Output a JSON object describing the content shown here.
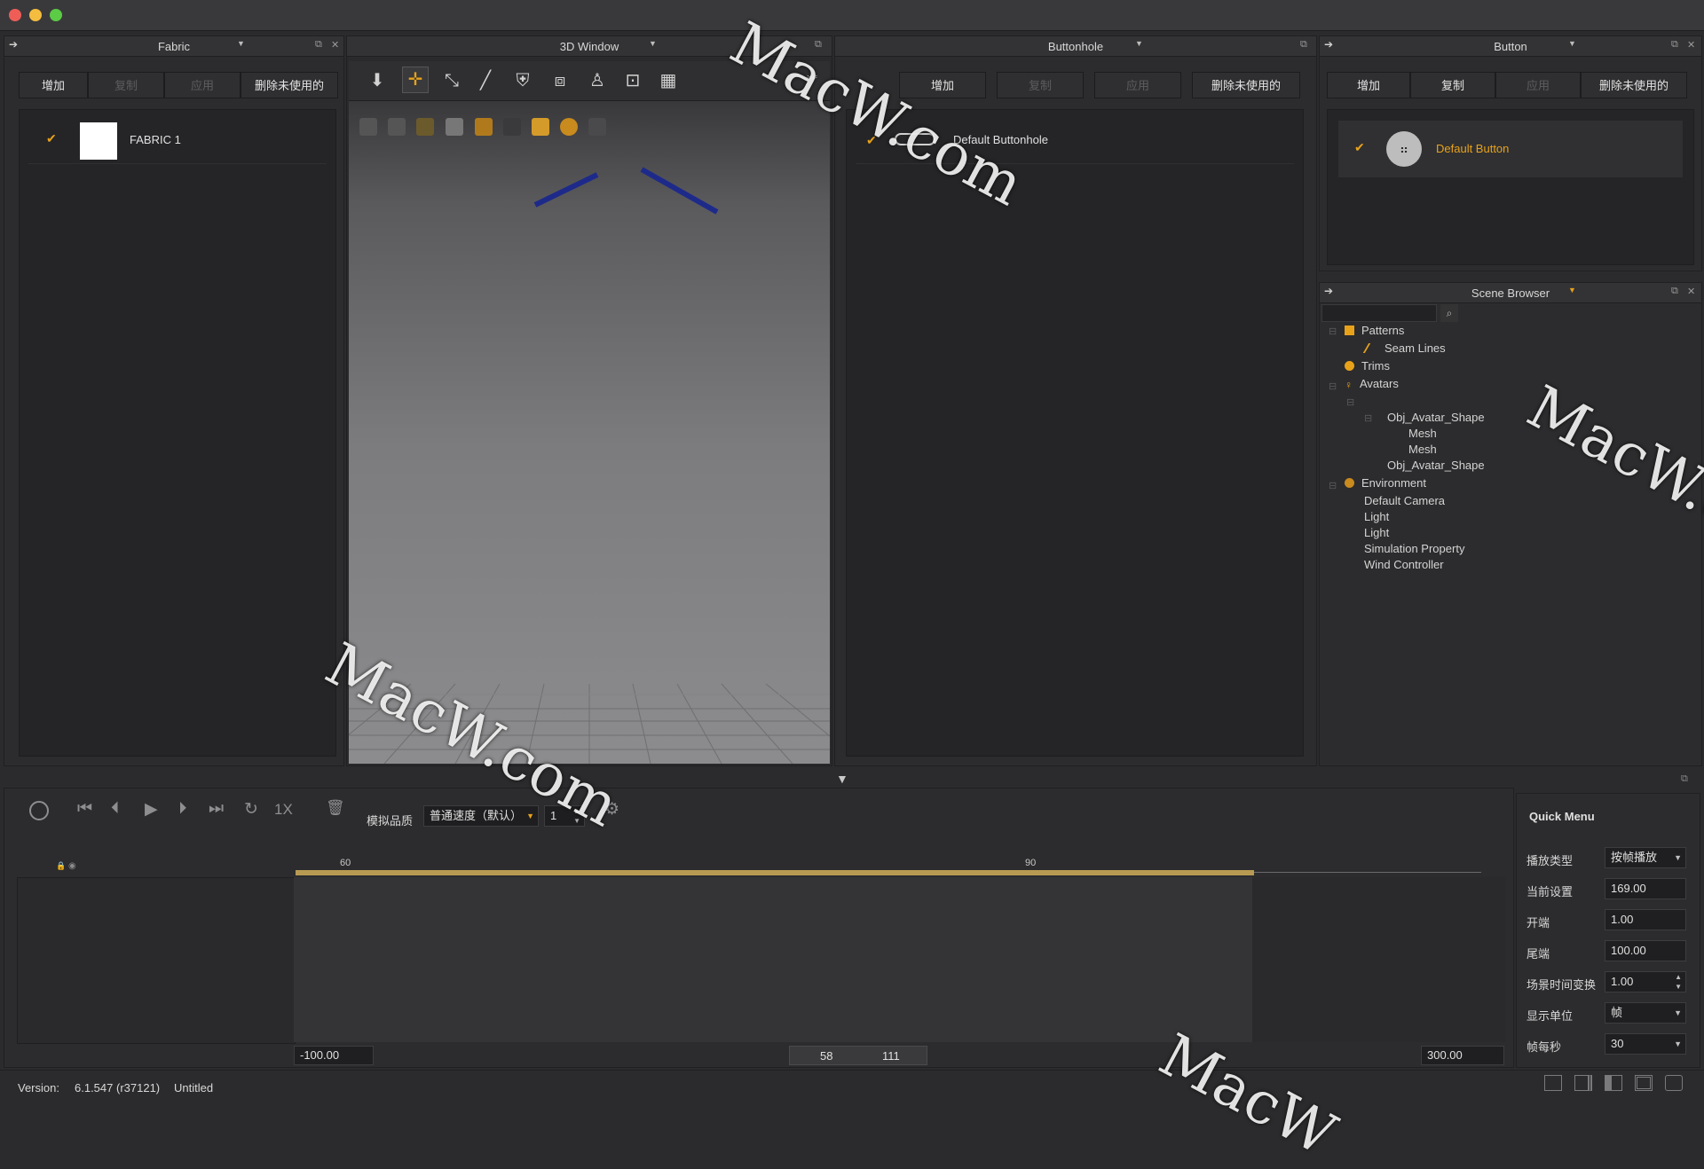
{
  "fabric_panel": {
    "title": "Fabric",
    "buttons": [
      "增加",
      "复制",
      "应用",
      "删除未使用的"
    ],
    "items": [
      {
        "name": "FABRIC 1"
      }
    ]
  },
  "window3d_panel": {
    "title": "3D Window"
  },
  "buttonhole_panel": {
    "title": "Buttonhole",
    "buttons": [
      "增加",
      "复制",
      "应用",
      "删除未使用的"
    ],
    "items": [
      {
        "name": "Default Buttonhole"
      }
    ]
  },
  "button_panel": {
    "title": "Button",
    "buttons": [
      "增加",
      "复制",
      "应用",
      "删除未使用的"
    ],
    "items": [
      {
        "name": "Default Button"
      }
    ]
  },
  "scene_browser": {
    "title": "Scene Browser",
    "search_placeholder": "",
    "tree": {
      "patterns": "Patterns",
      "seam_lines": "Seam Lines",
      "trims": "Trims",
      "avatars": "Avatars",
      "avatar_shape_1": "Obj_Avatar_Shape",
      "mesh_1": "Mesh",
      "mesh_2": "Mesh",
      "avatar_shape_2": "Obj_Avatar_Shape",
      "environment": "Environment",
      "default_camera": "Default Camera",
      "light_1": "Light",
      "light_2": "Light",
      "simulation_property": "Simulation Property",
      "wind_controller": "Wind Controller"
    }
  },
  "timeline": {
    "speed_label": "1X",
    "quality_label": "模拟品质",
    "quality_value": "普通速度（默认）",
    "step_value": "1",
    "ruler_60": "60",
    "ruler_90": "90",
    "range_start": "-100.00",
    "range_end": "300.00",
    "window_start": "58",
    "window_end": "111"
  },
  "quick_menu": {
    "title": "Quick Menu",
    "rows": [
      {
        "label": "播放类型",
        "value": "按帧播放"
      },
      {
        "label": "当前设置",
        "value": "169.00"
      },
      {
        "label": "开端",
        "value": "1.00"
      },
      {
        "label": "尾端",
        "value": "100.00"
      },
      {
        "label": "场景时间变换",
        "value": "1.00"
      },
      {
        "label": "显示单位",
        "value": "帧"
      },
      {
        "label": "帧每秒",
        "value": "30"
      }
    ]
  },
  "status_bar": {
    "version_label": "Version:",
    "version_value": "6.1.547 (r37121)",
    "file_name": "Untitled"
  },
  "watermark": {
    "text_1": "MacW.com",
    "text_2": "MacW.com",
    "text_3": "MacW.c",
    "text_4": "MacW"
  },
  "colors": {
    "accent_orange": "#e8a21a",
    "timeline_gold": "#b89a52",
    "panel_bg": "#2c2c2e"
  }
}
